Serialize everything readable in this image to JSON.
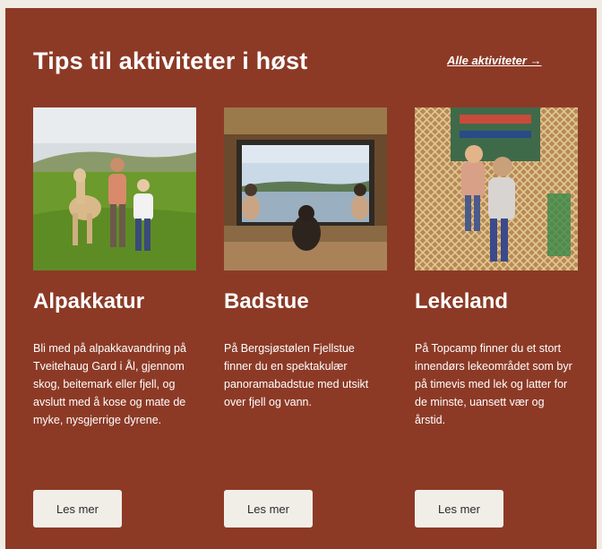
{
  "section": {
    "heading": "Tips til aktiviteter i høst",
    "all_link": "Alle aktiviteter →"
  },
  "cards": [
    {
      "title": "Alpakkatur",
      "text": "Bli med på alpakkavandring på Tveitehaug Gard i Ål, gjennom skog, beitemark eller fjell, og avslutt med å kose og mate de myke, nysgjerrige dyrene.",
      "button": "Les mer"
    },
    {
      "title": "Badstue",
      "text": "På Bergsjøstølen Fjellstue finner du en spektakulær panoramabadstue med utsikt over fjell og vann.",
      "button": "Les mer"
    },
    {
      "title": "Lekeland",
      "text": "På Topcamp finner du et stort innendørs lekeområdet som byr på timevis med lek og latter for de minste, uansett vær og årstid.",
      "button": "Les mer"
    }
  ],
  "colors": {
    "panel_background": "#8c3a26",
    "page_background": "#f0ebe3",
    "button_background": "#f1eee8"
  }
}
